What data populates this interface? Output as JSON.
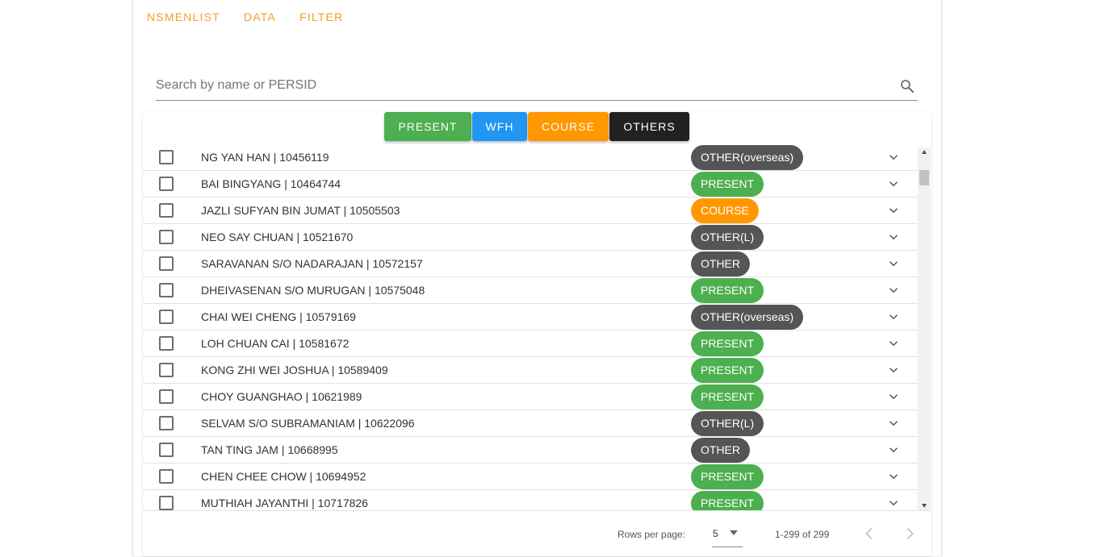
{
  "nav_tabs": [
    "NSMENLIST",
    "DATA",
    "FILTER"
  ],
  "search": {
    "placeholder": "Search by name or PERSID",
    "value": ""
  },
  "filters": [
    {
      "label": "PRESENT",
      "color": "#4caf50"
    },
    {
      "label": "WFH",
      "color": "#2196f3"
    },
    {
      "label": "COURSE",
      "color": "#ff9800"
    },
    {
      "label": "OTHERS",
      "color": "#212121"
    }
  ],
  "status_colors": {
    "present": "#4caf50",
    "course": "#ff9800",
    "other": "#555555"
  },
  "rows": [
    {
      "name": "NG YAN HAN | 10456119",
      "status": "OTHER(overseas)",
      "kind": "other"
    },
    {
      "name": "BAI BINGYANG | 10464744",
      "status": "PRESENT",
      "kind": "present"
    },
    {
      "name": "JAZLI SUFYAN BIN JUMAT | 10505503",
      "status": "COURSE",
      "kind": "course"
    },
    {
      "name": "NEO SAY CHUAN | 10521670",
      "status": "OTHER(L)",
      "kind": "other"
    },
    {
      "name": "SARAVANAN S/O NADARAJAN | 10572157",
      "status": "OTHER",
      "kind": "other"
    },
    {
      "name": "DHEIVASENAN S/O MURUGAN | 10575048",
      "status": "PRESENT",
      "kind": "present"
    },
    {
      "name": "CHAI WEI CHENG | 10579169",
      "status": "OTHER(overseas)",
      "kind": "other"
    },
    {
      "name": "LOH CHUAN CAI | 10581672",
      "status": "PRESENT",
      "kind": "present"
    },
    {
      "name": "KONG ZHI WEI JOSHUA | 10589409",
      "status": "PRESENT",
      "kind": "present"
    },
    {
      "name": "CHOY GUANGHAO | 10621989",
      "status": "PRESENT",
      "kind": "present"
    },
    {
      "name": "SELVAM S/O SUBRAMANIAM | 10622096",
      "status": "OTHER(L)",
      "kind": "other"
    },
    {
      "name": "TAN TING JAM | 10668995",
      "status": "OTHER",
      "kind": "other"
    },
    {
      "name": "CHEN CHEE CHOW | 10694952",
      "status": "PRESENT",
      "kind": "present"
    },
    {
      "name": "MUTHIAH JAYANTHI | 10717826",
      "status": "PRESENT",
      "kind": "present"
    }
  ],
  "pagination": {
    "rows_per_page_label": "Rows per page:",
    "rows_per_page_value": "5",
    "range_text": "1-299 of 299"
  },
  "icons": {
    "search": "search-icon",
    "row_expand": "chevron-down-icon",
    "select_caret": "caret-down-icon",
    "prev": "chevron-left-icon",
    "next": "chevron-right-icon"
  }
}
